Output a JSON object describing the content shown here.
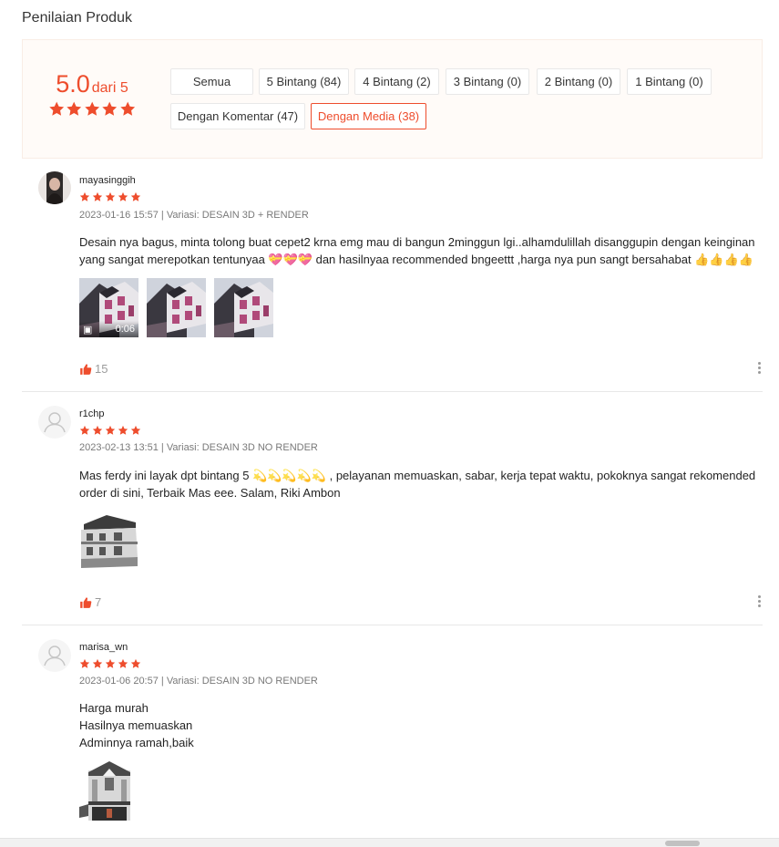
{
  "section_title": "Penilaian Produk",
  "overview": {
    "score": "5.0",
    "score_of": "dari 5",
    "rating": 5,
    "max_rating": 5,
    "filters": [
      {
        "label": "Semua",
        "active": false
      },
      {
        "label": "5 Bintang (84)",
        "active": false
      },
      {
        "label": "4 Bintang (2)",
        "active": false
      },
      {
        "label": "3 Bintang (0)",
        "active": false
      },
      {
        "label": "2 Bintang (0)",
        "active": false
      },
      {
        "label": "1 Bintang (0)",
        "active": false
      },
      {
        "label": "Dengan Komentar (47)",
        "active": false
      },
      {
        "label": "Dengan Media (38)",
        "active": true
      }
    ]
  },
  "colors": {
    "accent": "#ee4d2d",
    "overview_bg": "#fffbf8"
  },
  "reviews": [
    {
      "username": "mayasinggih",
      "rating": 5,
      "meta": "2023-01-16 15:57 | Variasi: DESAIN 3D + RENDER",
      "lines": [
        "Desain nya bagus, minta tolong buat cepet2 krna emg mau di bangun 2minggun lgi..alhamdulillah disanggupin dengan keinginan yang sangat merepotkan tentunyaa  💝💝💝  dan hasilnyaa recommended bngeettt ,harga nya pun sangt bersahabat 👍👍👍👍"
      ],
      "video_duration": "0:06",
      "likes": "15"
    },
    {
      "username": "r1chp",
      "rating": 5,
      "meta": "2023-02-13 13:51 | Variasi: DESAIN 3D NO RENDER",
      "lines": [
        "Mas ferdy ini layak dpt bintang 5 💫💫💫💫💫 , pelayanan memuaskan, sabar, kerja tepat waktu, pokoknya sangat rekomended order di sini, Terbaik Mas eee. Salam, Riki Ambon"
      ],
      "likes": "7"
    },
    {
      "username": "marisa_wn",
      "rating": 5,
      "meta": "2023-01-06 20:57 | Variasi: DESAIN 3D NO RENDER",
      "lines": [
        "Harga murah",
        "Hasilnya memuaskan",
        "Adminnya ramah,baik"
      ]
    }
  ]
}
